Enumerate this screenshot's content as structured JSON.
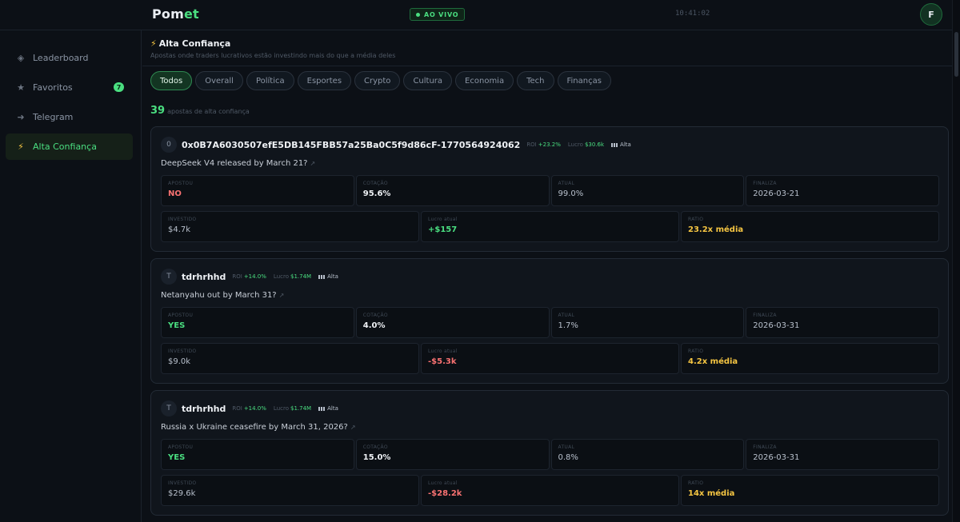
{
  "header": {
    "logo_main": "Pom",
    "logo_accent": "et",
    "live_label": "AO VIVO",
    "clock": "10:41:02",
    "avatar_letter": "F"
  },
  "sidebar": {
    "items": [
      {
        "label": "Leaderboard",
        "icon": "diamond-icon"
      },
      {
        "label": "Favoritos",
        "icon": "star-icon",
        "badge": "7"
      },
      {
        "label": "Telegram",
        "icon": "send-icon"
      },
      {
        "label": "Alta Confiança",
        "icon": "lightning-icon",
        "active": true
      }
    ]
  },
  "page": {
    "title": "Alta Confiança",
    "subtitle": "Apostas onde traders lucrativos estão investindo mais do que a média deles",
    "count": "39",
    "count_label": "apostas de alta confiança"
  },
  "filters": [
    "Todos",
    "Overall",
    "Política",
    "Esportes",
    "Crypto",
    "Cultura",
    "Economia",
    "Tech",
    "Finanças"
  ],
  "cards": [
    {
      "avatar": "0",
      "trader": "0x0B7A6030507efE5DB145FBB57a25Ba0C5f9d86cF-1770564924062",
      "roi_label": "ROI",
      "roi": "+23.2%",
      "lucro_label": "Lucro",
      "lucro": "$30.6k",
      "confidence": "Alta",
      "question": "DeepSeek V4 released by March 21?",
      "apostou_label": "APOSTOU",
      "apostou": "NO",
      "cotacao_label": "COTAÇÃO",
      "cotacao": "95.6%",
      "atual_label": "ATUAL",
      "atual": "99.0%",
      "finaliza_label": "FINALIZA",
      "finaliza": "2026-03-21",
      "investido_label": "INVESTIDO",
      "investido": "$4.7k",
      "lucro_atual_label": "Lucro atual",
      "lucro_atual": "+$157",
      "ratio_label": "RATIO",
      "ratio": "23.2x média"
    },
    {
      "avatar": "T",
      "trader": "tdrhrhhd",
      "roi_label": "ROI",
      "roi": "+14.0%",
      "lucro_label": "Lucro",
      "lucro": "$1.74M",
      "confidence": "Alta",
      "question": "Netanyahu out by March 31?",
      "apostou_label": "APOSTOU",
      "apostou": "YES",
      "cotacao_label": "COTAÇÃO",
      "cotacao": "4.0%",
      "atual_label": "ATUAL",
      "atual": "1.7%",
      "finaliza_label": "FINALIZA",
      "finaliza": "2026-03-31",
      "investido_label": "INVESTIDO",
      "investido": "$9.0k",
      "lucro_atual_label": "Lucro atual",
      "lucro_atual": "-$5.3k",
      "ratio_label": "RATIO",
      "ratio": "4.2x média"
    },
    {
      "avatar": "T",
      "trader": "tdrhrhhd",
      "roi_label": "ROI",
      "roi": "+14.0%",
      "lucro_label": "Lucro",
      "lucro": "$1.74M",
      "confidence": "Alta",
      "question": "Russia x Ukraine ceasefire by March 31, 2026?",
      "apostou_label": "APOSTOU",
      "apostou": "YES",
      "cotacao_label": "COTAÇÃO",
      "cotacao": "15.0%",
      "atual_label": "ATUAL",
      "atual": "0.8%",
      "finaliza_label": "FINALIZA",
      "finaliza": "2026-03-31",
      "investido_label": "INVESTIDO",
      "investido": "$29.6k",
      "lucro_atual_label": "Lucro atual",
      "lucro_atual": "-$28.2k",
      "ratio_label": "RATIO",
      "ratio": "14x média"
    }
  ],
  "colors": {
    "accent": "#4ade80",
    "negative": "#f87171",
    "ratio": "#f5c542",
    "background": "#0c1016"
  }
}
